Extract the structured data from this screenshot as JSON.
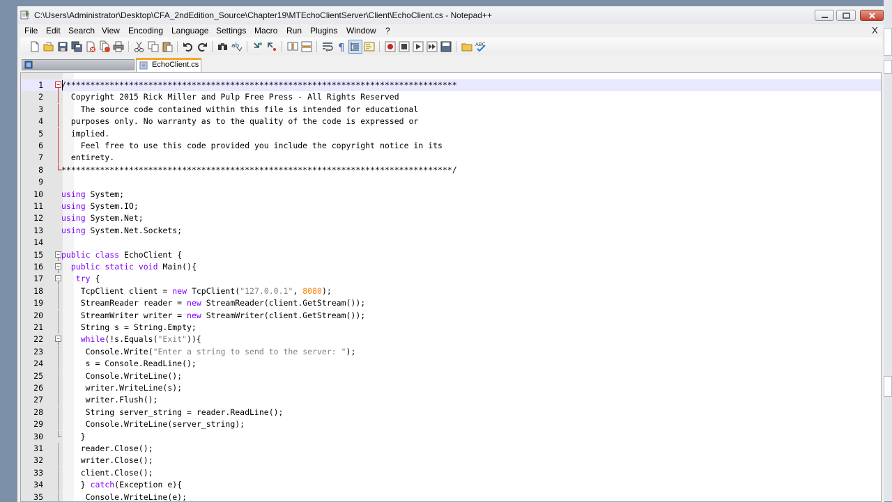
{
  "window": {
    "title": "C:\\Users\\Administrator\\Desktop\\CFA_2ndEdition_Source\\Chapter19\\MTEchoClientServer\\Client\\EchoClient.cs - Notepad++",
    "menu_close": "X"
  },
  "menu": [
    "File",
    "Edit",
    "Search",
    "View",
    "Encoding",
    "Language",
    "Settings",
    "Macro",
    "Run",
    "Plugins",
    "Window",
    "?"
  ],
  "tabs": {
    "active_label": "EchoClient.cs"
  },
  "toolbar_icons": [
    "new-file-icon",
    "open-file-icon",
    "save-icon",
    "save-all-icon",
    "close-icon",
    "close-all-icon",
    "print-icon",
    "cut-icon",
    "copy-icon",
    "paste-icon",
    "undo-icon",
    "redo-icon",
    "find-icon",
    "replace-icon",
    "zoom-in-icon",
    "zoom-out-icon",
    "sync-vertical-icon",
    "sync-horizontal-icon",
    "word-wrap-icon",
    "show-all-chars-icon",
    "indent-guide-icon",
    "doc-map-icon",
    "record-macro-icon",
    "stop-record-icon",
    "play-macro-icon",
    "run-macro-multiple-icon",
    "save-macro-icon",
    "folder-workspace-icon",
    "spellcheck-icon"
  ],
  "colors": {
    "keyword": "#8000ff",
    "type": "#000080",
    "string": "#808080",
    "number": "#ff8000",
    "current_line": "#e8e8ff",
    "tab_accent": "#f5a623"
  },
  "editor": {
    "current_line": 1,
    "lines": [
      {
        "n": "1",
        "t": "/*********************************************************************************"
      },
      {
        "n": "2",
        "t": "  Copyright 2015 Rick Miller and Pulp Free Press - All Rights Reserved"
      },
      {
        "n": "3",
        "t": "    The source code contained within this file is intended for educational"
      },
      {
        "n": "4",
        "t": "  purposes only. No warranty as to the quality of the code is expressed or"
      },
      {
        "n": "5",
        "t": "  implied."
      },
      {
        "n": "6",
        "t": "    Feel free to use this code provided you include the copyright notice in its"
      },
      {
        "n": "7",
        "t": "  entirety."
      },
      {
        "n": "8",
        "t": "*********************************************************************************/"
      },
      {
        "n": "9",
        "t": ""
      },
      {
        "n": "10",
        "t": "using System;"
      },
      {
        "n": "11",
        "t": "using System.IO;"
      },
      {
        "n": "12",
        "t": "using System.Net;"
      },
      {
        "n": "13",
        "t": "using System.Net.Sockets;"
      },
      {
        "n": "14",
        "t": ""
      },
      {
        "n": "15",
        "t": "public class EchoClient {"
      },
      {
        "n": "16",
        "t": "  public static void Main(){"
      },
      {
        "n": "17",
        "t": "   try {"
      },
      {
        "n": "18",
        "t": "    TcpClient client = new TcpClient(\"127.0.0.1\", 8080);"
      },
      {
        "n": "19",
        "t": "    StreamReader reader = new StreamReader(client.GetStream());"
      },
      {
        "n": "20",
        "t": "    StreamWriter writer = new StreamWriter(client.GetStream());"
      },
      {
        "n": "21",
        "t": "    String s = String.Empty;"
      },
      {
        "n": "22",
        "t": "    while(!s.Equals(\"Exit\")){"
      },
      {
        "n": "23",
        "t": "     Console.Write(\"Enter a string to send to the server: \");"
      },
      {
        "n": "24",
        "t": "     s = Console.ReadLine();"
      },
      {
        "n": "25",
        "t": "     Console.WriteLine();"
      },
      {
        "n": "26",
        "t": "     writer.WriteLine(s);"
      },
      {
        "n": "27",
        "t": "     writer.Flush();"
      },
      {
        "n": "28",
        "t": "     String server_string = reader.ReadLine();"
      },
      {
        "n": "29",
        "t": "     Console.WriteLine(server_string);"
      },
      {
        "n": "30",
        "t": "    }"
      },
      {
        "n": "31",
        "t": "    reader.Close();"
      },
      {
        "n": "32",
        "t": "    writer.Close();"
      },
      {
        "n": "33",
        "t": "    client.Close();"
      },
      {
        "n": "34",
        "t": "    } catch(Exception e){"
      },
      {
        "n": "35",
        "t": "     Console.WriteLine(e);"
      }
    ]
  }
}
